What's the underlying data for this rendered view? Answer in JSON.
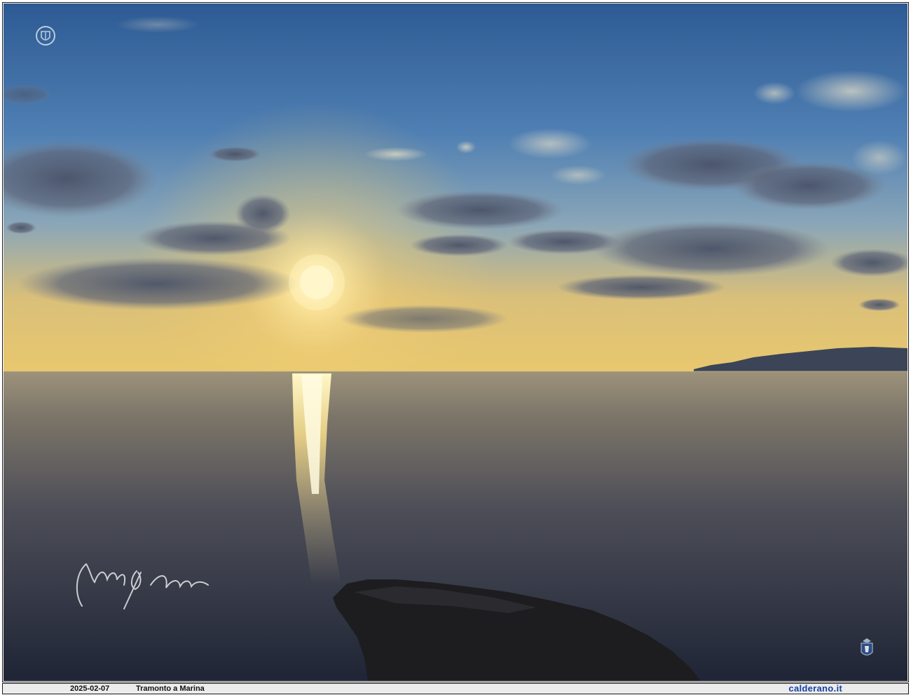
{
  "photo": {
    "subject": "sunset over calm sea",
    "signature_text": "Caldera",
    "colors": {
      "sky_top": "#2f5c95",
      "sky_mid": "#5f8ab8",
      "horizon_glow": "#e9c46a",
      "sun": "#fff6c8",
      "sea_near": "#23293a",
      "sea_far": "#9a8e6e",
      "rock": "#1c1c1e",
      "headland": "#3a4354"
    }
  },
  "caption": {
    "date": "2025-02-07",
    "title": "Tramonto a Marina",
    "site": "calderano.it"
  },
  "icons": {
    "top_logo": "crest-logo-icon",
    "bottom_logo": "coat-of-arms-icon"
  }
}
